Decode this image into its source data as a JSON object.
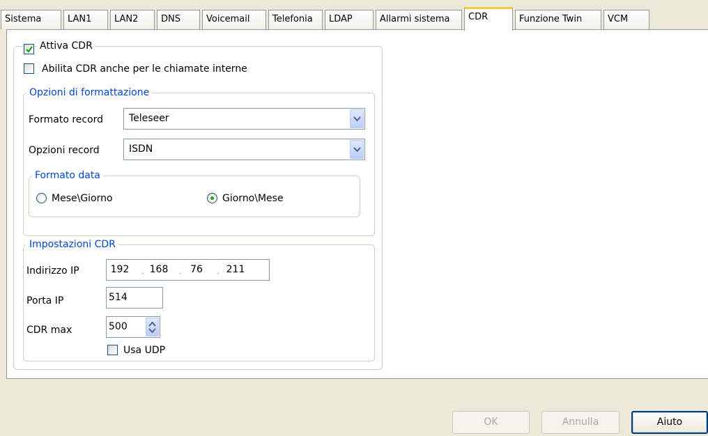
{
  "tabs": [
    "Sistema",
    "LAN1",
    "LAN2",
    "DNS",
    "Voicemail",
    "Telefonia",
    "LDAP",
    "Allarmi sistema",
    "CDR",
    "Funzione Twin",
    "VCM"
  ],
  "active_tab": "CDR",
  "cdr": {
    "attiva_label": "Attiva CDR",
    "attiva_checked": true,
    "interne_label": "Abilita CDR anche per le chiamate interne",
    "interne_checked": false
  },
  "formattazione": {
    "legend": "Opzioni di formattazione",
    "formato_record_label": "Formato record",
    "formato_record_value": "Teleseer",
    "opzioni_record_label": "Opzioni record",
    "opzioni_record_value": "ISDN",
    "formato_data": {
      "legend": "Formato data",
      "option_mese_giorno": "Mese\\Giorno",
      "option_giorno_mese": "Giorno\\Mese",
      "selected": "Giorno\\Mese"
    }
  },
  "impostazioni": {
    "legend": "Impostazioni CDR",
    "ip_label": "Indirizzo IP",
    "ip": [
      "192",
      "168",
      "76",
      "211"
    ],
    "porta_label": "Porta IP",
    "porta_value": "514",
    "cdrmax_label": "CDR max",
    "cdrmax_value": "500",
    "udp_label": "Usa UDP",
    "udp_checked": false
  },
  "buttons": {
    "ok": "OK",
    "annulla": "Annulla",
    "aiuto": "Aiuto"
  }
}
